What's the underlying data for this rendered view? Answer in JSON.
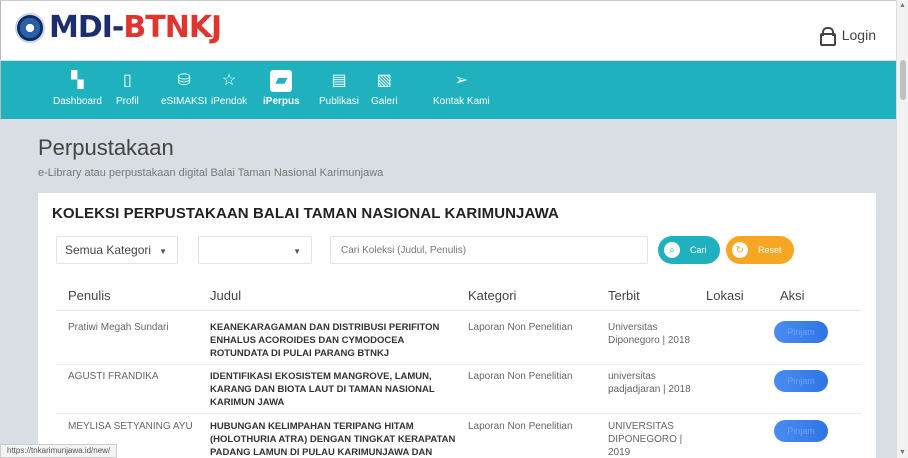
{
  "header": {
    "logo_text_main": "MDI-",
    "logo_text_accent": "BTNKJ",
    "login_label": "Login"
  },
  "nav": {
    "items": [
      {
        "label": "Dashboard",
        "icon": "dashboard-icon",
        "glyph": "▚"
      },
      {
        "label": "Profil",
        "icon": "profile-icon",
        "glyph": "▯"
      },
      {
        "label": "eSIMAKSI",
        "icon": "esimaksi-icon",
        "glyph": "⛁"
      },
      {
        "label": "iPendok",
        "icon": "star-icon",
        "glyph": "☆"
      },
      {
        "label": "iPerpus",
        "icon": "book-icon",
        "glyph": "▰"
      },
      {
        "label": "Publikasi",
        "icon": "document-icon",
        "glyph": "▤"
      },
      {
        "label": "Galeri",
        "icon": "image-icon",
        "glyph": "▧"
      },
      {
        "label": "Kontak Kami",
        "icon": "send-icon",
        "glyph": "➢"
      }
    ],
    "active_index": 4
  },
  "page": {
    "title": "Perpustakaan",
    "subtitle": "e-Library atau perpustakaan digital Balai Taman Nasional Karimunjawa"
  },
  "collection": {
    "title": "KOLEKSI PERPUSTAKAAN BALAI TAMAN NASIONAL KARIMUNJAWA",
    "filters": {
      "category_value": "Semua Kategori",
      "second_select_value": "",
      "search_placeholder": "Cari Koleksi (Judul, Penulis)",
      "search_button": "Cari",
      "reset_button": "Reset"
    },
    "columns": [
      "Penulis",
      "Judul",
      "Kategori",
      "Terbit",
      "Lokasi",
      "Aksi"
    ],
    "rows": [
      {
        "penulis": "Pratiwi Megah Sundari",
        "judul_lines": [
          "KEANEKARAGAMAN DAN DISTRIBUSI PERIFITON",
          "ENHALUS ACOROIDES DAN CYMODOCEA",
          "ROTUNDATA DI PULAI PARANG BTNKJ"
        ],
        "kategori": "Laporan Non Penelitian",
        "terbit_lines": [
          "Universitas",
          "Diponegoro | 2018"
        ],
        "lokasi": "",
        "aksi": "Pinjam"
      },
      {
        "penulis": "AGUSTI FRANDIKA",
        "judul_lines": [
          "IDENTIFIKASI EKOSISTEM MANGROVE, LAMUN,",
          "KARANG DAN BIOTA LAUT DI TAMAN NASIONAL",
          "KARIMUN JAWA"
        ],
        "kategori": "Laporan Non Penelitian",
        "terbit_lines": [
          "universitas",
          "padjadjaran | 2018"
        ],
        "lokasi": "",
        "aksi": "Pinjam"
      },
      {
        "penulis": "MEYLISA SETYANING AYU",
        "judul_lines": [
          "HUBUNGAN KELIMPAHAN TERIPANG HITAM",
          "(HOLOTHURIA ATRA) DENGAN TINGKAT KERAPATAN",
          "PADANG LAMUN DI PULAU KARIMUNJAWA DAN"
        ],
        "kategori": "Laporan Non Penelitian",
        "terbit_lines": [
          "UNIVERSITAS",
          "DIPONEGORO |",
          "2019"
        ],
        "lokasi": "",
        "aksi": "Pinjam"
      }
    ]
  },
  "status_bar": {
    "url": "https://tnkarimunjawa.id/new/"
  },
  "colors": {
    "nav_bg": "#20b1be",
    "reset_orange": "#f6a623",
    "action_blue": "#3a7fe9"
  }
}
